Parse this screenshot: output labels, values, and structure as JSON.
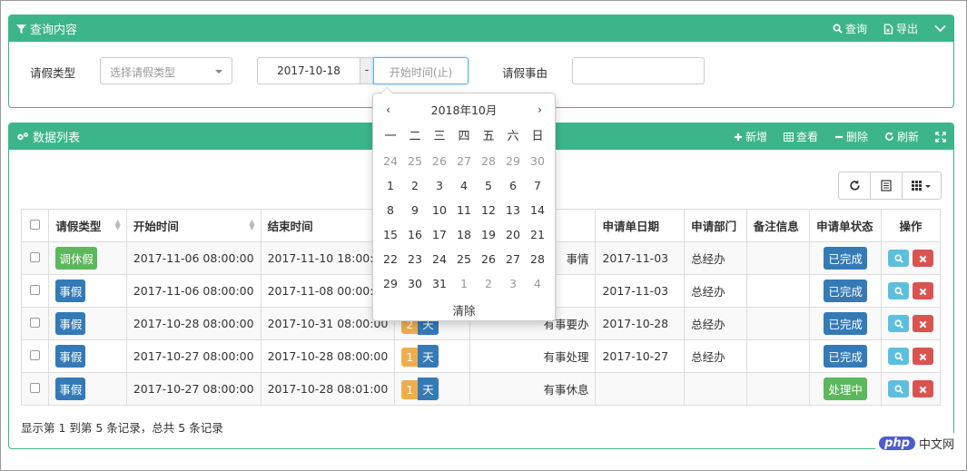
{
  "query_panel": {
    "title": "查询内容",
    "search_label": "查询",
    "export_label": "导出"
  },
  "filters": {
    "leave_type_label": "请假类型",
    "leave_type_placeholder": "选择请假类型",
    "start_date_value": "2017-10-18",
    "date_separator": "-",
    "end_date_placeholder": "开始时间(止)",
    "reason_label": "请假事由",
    "reason_value": ""
  },
  "calendar": {
    "month_title": "2018年10月",
    "prev": "‹",
    "next": "›",
    "weekdays": [
      "一",
      "二",
      "三",
      "四",
      "五",
      "六",
      "日"
    ],
    "days": [
      {
        "d": "24",
        "muted": true
      },
      {
        "d": "25",
        "muted": true
      },
      {
        "d": "26",
        "muted": true
      },
      {
        "d": "27",
        "muted": true
      },
      {
        "d": "28",
        "muted": true
      },
      {
        "d": "29",
        "muted": true
      },
      {
        "d": "30",
        "muted": true
      },
      {
        "d": "1"
      },
      {
        "d": "2"
      },
      {
        "d": "3"
      },
      {
        "d": "4"
      },
      {
        "d": "5"
      },
      {
        "d": "6"
      },
      {
        "d": "7"
      },
      {
        "d": "8"
      },
      {
        "d": "9"
      },
      {
        "d": "10"
      },
      {
        "d": "11"
      },
      {
        "d": "12"
      },
      {
        "d": "13"
      },
      {
        "d": "14"
      },
      {
        "d": "15"
      },
      {
        "d": "16"
      },
      {
        "d": "17"
      },
      {
        "d": "18"
      },
      {
        "d": "19"
      },
      {
        "d": "20"
      },
      {
        "d": "21"
      },
      {
        "d": "22"
      },
      {
        "d": "23"
      },
      {
        "d": "24"
      },
      {
        "d": "25"
      },
      {
        "d": "26"
      },
      {
        "d": "27"
      },
      {
        "d": "28"
      },
      {
        "d": "29"
      },
      {
        "d": "30"
      },
      {
        "d": "31"
      },
      {
        "d": "1",
        "muted": true
      },
      {
        "d": "2",
        "muted": true
      },
      {
        "d": "3",
        "muted": true
      },
      {
        "d": "4",
        "muted": true
      }
    ],
    "clear_label": "清除"
  },
  "list_panel": {
    "title": "数据列表",
    "add_label": "新增",
    "view_label": "查看",
    "delete_label": "删除",
    "refresh_label": "刷新"
  },
  "table": {
    "headers": [
      "请假类型",
      "开始时间",
      "结束时间",
      "",
      "",
      "申请单日期",
      "申请部门",
      "备注信息",
      "申请单状态",
      "操作"
    ],
    "rows": [
      {
        "type": "调休假",
        "type_color": "#5cb85c",
        "start": "2017-11-06 08:00:00",
        "end": "2017-11-10 18:00:00",
        "days": "",
        "unit": "",
        "reason": "事情",
        "apply_date": "2017-11-03",
        "dept": "总经办",
        "note": "",
        "status": "已完成",
        "status_color": "#337ab7"
      },
      {
        "type": "事假",
        "type_color": "#337ab7",
        "start": "2017-11-06 08:00:00",
        "end": "2017-11-08 00:00:00",
        "days": "",
        "unit": "",
        "reason": "",
        "apply_date": "2017-11-03",
        "dept": "总经办",
        "note": "",
        "status": "已完成",
        "status_color": "#337ab7"
      },
      {
        "type": "事假",
        "type_color": "#337ab7",
        "start": "2017-10-28 08:00:00",
        "end": "2017-10-31 08:00:00",
        "days": "2",
        "unit": "天",
        "reason": "有事要办",
        "apply_date": "2017-10-28",
        "dept": "总经办",
        "note": "",
        "status": "已完成",
        "status_color": "#337ab7"
      },
      {
        "type": "事假",
        "type_color": "#337ab7",
        "start": "2017-10-27 08:00:00",
        "end": "2017-10-28 08:00:00",
        "days": "1",
        "unit": "天",
        "reason": "有事处理",
        "apply_date": "2017-10-27",
        "dept": "总经办",
        "note": "",
        "status": "已完成",
        "status_color": "#337ab7"
      },
      {
        "type": "事假",
        "type_color": "#337ab7",
        "start": "2017-10-27 08:00:00",
        "end": "2017-10-28 08:01:00",
        "days": "1",
        "unit": "天",
        "reason": "有事休息",
        "apply_date": "",
        "dept": "",
        "note": "",
        "status": "处理中",
        "status_color": "#5cb85c"
      }
    ]
  },
  "footer": {
    "summary": "显示第 1 到第 5 条记录，总共 5 条记录"
  },
  "watermark": {
    "logo": "php",
    "site": "中文网"
  },
  "colors": {
    "panel_header": "#3db58a",
    "primary": "#337ab7",
    "success": "#5cb85c",
    "info": "#5bc0de",
    "danger": "#d9534f",
    "warning": "#f0ad4e"
  },
  "icons": [
    "filter-icon",
    "search-icon",
    "export-icon",
    "chevron-down-icon",
    "cogs-icon",
    "plus-icon",
    "table-icon",
    "minus-icon",
    "refresh-icon",
    "expand-icon",
    "list-icon",
    "grid-icon"
  ]
}
